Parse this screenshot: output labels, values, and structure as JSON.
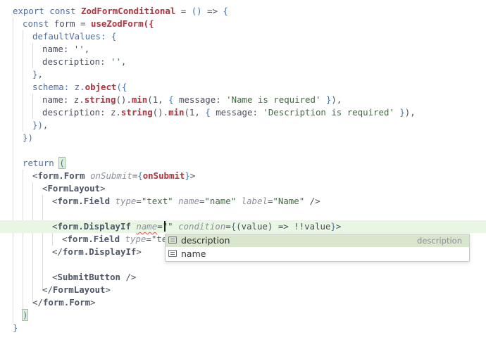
{
  "code": {
    "line1": {
      "t1": "export",
      "t2": " ",
      "t3": "const",
      "t4": " ",
      "t5": "ZodFormConditional",
      "t6": " = ",
      "t7": "()",
      "t8": " => ",
      "t9": "{"
    },
    "line2": {
      "t1": "const",
      "t2": " form = ",
      "t3": "useZodForm",
      "t4": "({"
    },
    "line3": {
      "t1": "defaultValues: ",
      "t2": "{"
    },
    "line4": {
      "t1": "name: ",
      "t2": "''",
      "t3": ","
    },
    "line5": {
      "t1": "description: ",
      "t2": "''",
      "t3": ","
    },
    "line6": {
      "t1": "}",
      "t2": ","
    },
    "line7": {
      "t1": "schema: z.",
      "t2": "object",
      "t3": "({"
    },
    "line8": {
      "t1": "name: z.",
      "t2": "string",
      "t3": "().",
      "t4": "min",
      "t5": "(1, ",
      "t6": "{",
      "t7": " message: ",
      "t8": "'Name is required'",
      "t9": " }",
      "t10": "),"
    },
    "line9": {
      "t1": "description: z.",
      "t2": "string",
      "t3": "().",
      "t4": "min",
      "t5": "(1, ",
      "t6": "{",
      "t7": " message: ",
      "t8": "'Description is required'",
      "t9": " }",
      "t10": "),"
    },
    "line10": {
      "t1": "})",
      "t2": ","
    },
    "line11": {
      "t1": "})"
    },
    "line13": {
      "t1": "return",
      "t2": " ",
      "t3": "("
    },
    "line14": {
      "t1": "<",
      "t2": "form.Form",
      "t3": " ",
      "t4": "onSubmit",
      "t5": "=",
      "t6": "{",
      "t7": "onSubmit",
      "t8": "}",
      "t9": ">"
    },
    "line15": {
      "t1": "<",
      "t2": "FormLayout",
      "t3": ">"
    },
    "line16": {
      "t1": "<",
      "t2": "form.Field",
      "t3": " ",
      "t4": "type",
      "t5": "=",
      "t6": "\"text\"",
      "t7": " ",
      "t8": "name",
      "t9": "=",
      "t10": "\"name\"",
      "t11": " ",
      "t12": "label",
      "t13": "=",
      "t14": "\"Name\"",
      "t15": " />"
    },
    "line18": {
      "t1": "<",
      "t2": "form.DisplayIf",
      "t3": " ",
      "t4": "name",
      "t5": "=",
      "t6": "\"",
      "t7": "\"",
      "t8": " ",
      "t9": "condition",
      "t10": "=",
      "t11": "{",
      "t12": "(value) => !!value",
      "t13": "}",
      "t14": ">"
    },
    "line19": {
      "t1": "<",
      "t2": "form.Field",
      "t3": " ",
      "t4": "type",
      "t5": "=",
      "t6": "\"te"
    },
    "line20": {
      "t1": "</",
      "t2": "form.DisplayIf",
      "t3": ">"
    },
    "line22": {
      "t1": "<",
      "t2": "SubmitButton",
      "t3": " />"
    },
    "line23": {
      "t1": "</",
      "t2": "FormLayout",
      "t3": ">"
    },
    "line24": {
      "t1": "</",
      "t2": "form.Form",
      "t3": ">"
    },
    "line25": {
      "t1": ")"
    },
    "line26": {
      "t1": "}"
    }
  },
  "autocomplete": {
    "items": [
      {
        "label": "description",
        "detail": "description",
        "icon": "text-field-icon"
      },
      {
        "label": "name",
        "detail": "",
        "icon": "text-field-icon"
      }
    ]
  }
}
